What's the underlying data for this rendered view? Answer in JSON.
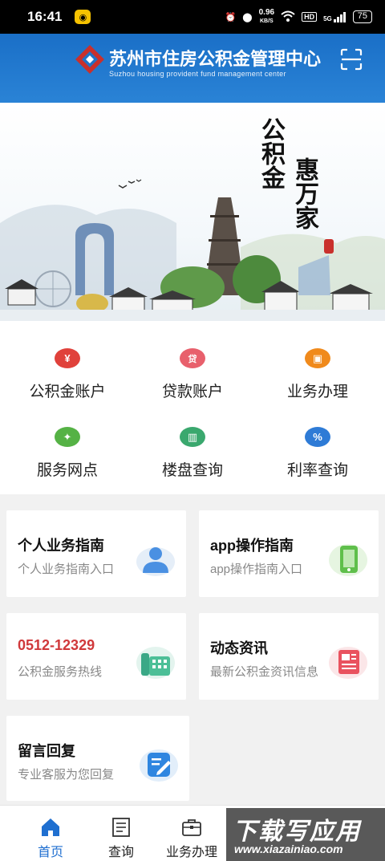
{
  "status_bar": {
    "time": "16:41",
    "speed_value": "0.96",
    "speed_unit": "KB/S",
    "hd": "HD",
    "network": "5G",
    "battery": "75"
  },
  "header": {
    "title": "苏州市住房公积金管理中心",
    "subtitle": "Suzhou housing provident fund management center",
    "logo_icon": "diamond-logo-icon",
    "scan_icon": "scan-icon"
  },
  "banner": {
    "calligraphy_left": "公积金",
    "calligraphy_right": "惠万家"
  },
  "quick_menu": [
    {
      "label": "公积金账户",
      "icon": "money-bag-icon",
      "color": "#e0413b",
      "glyph": "¥"
    },
    {
      "label": "贷款账户",
      "icon": "loan-bag-icon",
      "color": "#e8606c",
      "glyph": "贷"
    },
    {
      "label": "业务办理",
      "icon": "briefcase-icon",
      "color": "#f08a1c",
      "glyph": "▣"
    },
    {
      "label": "服务网点",
      "icon": "location-map-icon",
      "color": "#55b245",
      "glyph": "✦"
    },
    {
      "label": "楼盘查询",
      "icon": "building-icon",
      "color": "#3aa86e",
      "glyph": "▥"
    },
    {
      "label": "利率查询",
      "icon": "percent-icon",
      "color": "#2e7bd6",
      "glyph": "%"
    }
  ],
  "cards": [
    {
      "title": "个人业务指南",
      "subtitle": "个人业务指南入口",
      "icon": "person-icon"
    },
    {
      "title": "app操作指南",
      "subtitle": "app操作指南入口",
      "icon": "phone-icon"
    },
    {
      "title": "0512-12329",
      "subtitle": "公积金服务热线",
      "icon": "telephone-icon",
      "title_color": "#d0393b"
    },
    {
      "title": "动态资讯",
      "subtitle": "最新公积金资讯信息",
      "icon": "news-icon"
    },
    {
      "title": "留言回复",
      "subtitle": "专业客服为您回复",
      "icon": "message-icon"
    }
  ],
  "bottom_nav": [
    {
      "label": "首页",
      "icon": "home-icon",
      "active": true
    },
    {
      "label": "查询",
      "icon": "document-icon",
      "active": false
    },
    {
      "label": "业务办理",
      "icon": "briefcase-icon",
      "active": false
    }
  ],
  "watermark": {
    "text_cn": "下载写应用",
    "text_en": "www.xiazainiao.com"
  },
  "colors": {
    "header_blue": "#1a6fc7",
    "active_blue": "#1f6fd0",
    "hotline_red": "#d0393b"
  }
}
